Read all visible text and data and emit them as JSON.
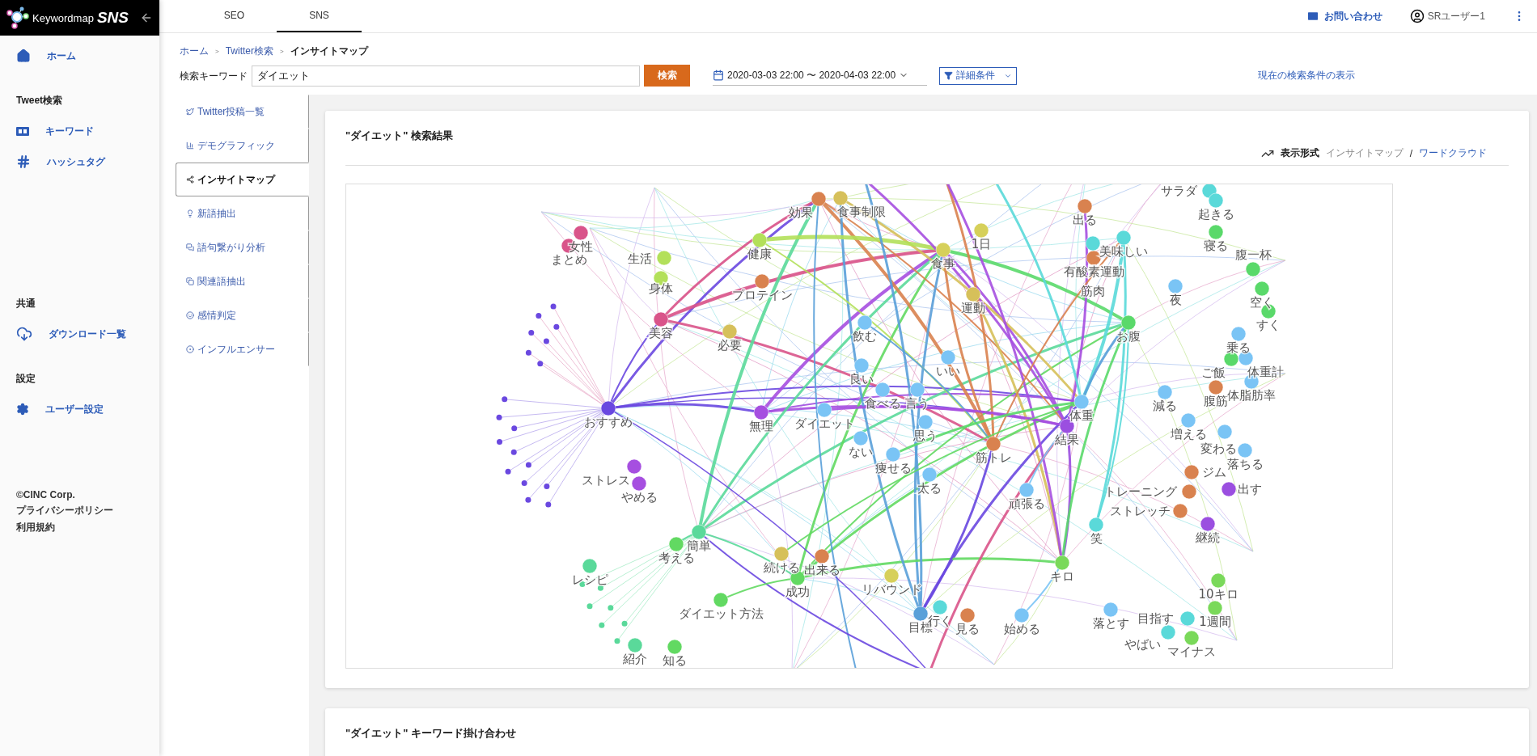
{
  "logo": {
    "name": "Keywordmap",
    "product": "SNS"
  },
  "sidebar": {
    "groups": [
      {
        "items": [
          {
            "label": "ホーム"
          }
        ]
      },
      {
        "heading": "Tweet検索",
        "items": [
          {
            "label": "キーワード"
          },
          {
            "label": "ハッシュタグ"
          }
        ]
      },
      {
        "heading": "共通",
        "items": [
          {
            "label": "ダウンロード一覧"
          }
        ]
      },
      {
        "heading": "設定",
        "items": [
          {
            "label": "ユーザー設定"
          }
        ]
      }
    ],
    "footer": [
      "©CINC Corp.",
      "プライバシーポリシー",
      "利用規約"
    ]
  },
  "top_tabs": [
    {
      "label": "SEO",
      "selected": false
    },
    {
      "label": "SNS",
      "selected": true
    }
  ],
  "header": {
    "contact": "お問い合わせ",
    "user": "SRユーザー1"
  },
  "breadcrumb": [
    "ホーム",
    "Twitter検索",
    "インサイトマップ"
  ],
  "breadcrumb_separator": ">",
  "search": {
    "label": "検索キーワード",
    "value": "ダイエット",
    "button": "検索",
    "date_range": "2020-03-03 22:00 〜 2020-04-03 22:00",
    "filter": "詳細条件",
    "show_conditions": "現在の検索条件の表示"
  },
  "subnav": [
    {
      "label": "Twitter投稿一覧",
      "selected": false
    },
    {
      "label": "デモグラフィック",
      "selected": false
    },
    {
      "label": "インサイトマップ",
      "selected": true
    },
    {
      "label": "新語抽出",
      "selected": false
    },
    {
      "label": "語句繋がり分析",
      "selected": false
    },
    {
      "label": "関連語抽出",
      "selected": false
    },
    {
      "label": "感情判定",
      "selected": false
    },
    {
      "label": "インフルエンサー",
      "selected": false
    }
  ],
  "result_card": {
    "title": "\"ダイエット\" 検索結果",
    "display_label": "表示形式",
    "display_separator": "/",
    "display_options": [
      {
        "label": "インサイトマップ",
        "selected": true
      },
      {
        "label": "ワードクラウド",
        "selected": false
      }
    ]
  },
  "network": {
    "nodes": [
      {
        "label": "女性",
        "color": "#d9548a"
      },
      {
        "label": "まとめ",
        "color": "#d9548a"
      },
      {
        "label": "生活",
        "color": "#b3e05a"
      },
      {
        "label": "身体",
        "color": "#b3e05a"
      },
      {
        "label": "美容",
        "color": "#d9548a"
      },
      {
        "label": "健康",
        "color": "#b3e05a"
      },
      {
        "label": "プロテイン",
        "color": "#d9824f"
      },
      {
        "label": "必要",
        "color": "#d6c05a"
      },
      {
        "label": "効果",
        "color": "#d9824f"
      },
      {
        "label": "食事制限",
        "color": "#d6c05a"
      },
      {
        "label": "食事",
        "color": "#d6d05a"
      },
      {
        "label": "おすすめ",
        "color": "#6a48e0"
      },
      {
        "label": "無理",
        "color": "#a64fe0"
      },
      {
        "label": "ストレス",
        "color": "#a64fe0"
      },
      {
        "label": "やめる",
        "color": "#a64fe0"
      },
      {
        "label": "簡単",
        "color": "#5ad99a"
      },
      {
        "label": "考える",
        "color": "#62d962"
      },
      {
        "label": "レシピ",
        "color": "#5ad99a"
      },
      {
        "label": "続ける",
        "color": "#d6c05a"
      },
      {
        "label": "出来る",
        "color": "#d9824f"
      },
      {
        "label": "成功",
        "color": "#62d962"
      },
      {
        "label": "リバウンド",
        "color": "#d6d05a"
      },
      {
        "label": "ダイエット方法",
        "color": "#62d962"
      },
      {
        "label": "紹介",
        "color": "#5ad99a"
      },
      {
        "label": "知る",
        "color": "#62d962"
      },
      {
        "label": "飲む",
        "color": "#7ac4f5"
      },
      {
        "label": "良い",
        "color": "#7ac4f5"
      },
      {
        "label": "食べる",
        "color": "#7ac4f5"
      },
      {
        "label": "言う",
        "color": "#7ac4f5"
      },
      {
        "label": "ダイエット",
        "color": "#7ac4f5"
      },
      {
        "label": "ない",
        "color": "#7ac4f5"
      },
      {
        "label": "痩せる",
        "color": "#7ac4f5"
      },
      {
        "label": "思う",
        "color": "#7ac4f5"
      },
      {
        "label": "太る",
        "color": "#7ac4f5"
      },
      {
        "label": "出る",
        "color": "#d9824f"
      },
      {
        "label": "1日",
        "color": "#d6d05a"
      },
      {
        "label": "美味しい",
        "color": "#5ad9d9"
      },
      {
        "label": "有酸素運動",
        "color": "#d9824f"
      },
      {
        "label": "筋肉",
        "color": "#5ad9d9"
      },
      {
        "label": "運動",
        "color": "#d6c05a"
      },
      {
        "label": "いい",
        "color": "#7ac4f5"
      },
      {
        "label": "お腹",
        "color": "#5ad96a"
      },
      {
        "label": "サラダ",
        "color": "#5ad9d9"
      },
      {
        "label": "起きる",
        "color": "#5ad9d9"
      },
      {
        "label": "寝る",
        "color": "#5ad96a"
      },
      {
        "label": "夜",
        "color": "#7ac4f5"
      },
      {
        "label": "腹一杯",
        "color": "#5ad96a"
      },
      {
        "label": "空く",
        "color": "#5ad96a"
      },
      {
        "label": "すく",
        "color": "#5ad96a"
      },
      {
        "label": "乗る",
        "color": "#7ac4f5"
      },
      {
        "label": "ご飯",
        "color": "#5ad96a"
      },
      {
        "label": "体重計",
        "color": "#7ac4f5"
      },
      {
        "label": "体脂肪率",
        "color": "#7ac4f5"
      },
      {
        "label": "減る",
        "color": "#7ac4f5"
      },
      {
        "label": "腹筋",
        "color": "#d9824f"
      },
      {
        "label": "体重",
        "color": "#7ac4f5"
      },
      {
        "label": "結果",
        "color": "#9b4fe0"
      },
      {
        "label": "筋トレ",
        "color": "#d9824f"
      },
      {
        "label": "増える",
        "color": "#7ac4f5"
      },
      {
        "label": "変わる",
        "color": "#7ac4f5"
      },
      {
        "label": "落ちる",
        "color": "#7ac4f5"
      },
      {
        "label": "ジム",
        "color": "#d9824f"
      },
      {
        "label": "トレーニング",
        "color": "#d9824f"
      },
      {
        "label": "出す",
        "color": "#9b4fe0"
      },
      {
        "label": "ストレッチ",
        "color": "#d9824f"
      },
      {
        "label": "継続",
        "color": "#9b4fe0"
      },
      {
        "label": "頑張る",
        "color": "#7ac4f5"
      },
      {
        "label": "笑",
        "color": "#5ad9d9"
      },
      {
        "label": "キロ",
        "color": "#7ad95a"
      },
      {
        "label": "10キロ",
        "color": "#7ad95a"
      },
      {
        "label": "目標",
        "color": "#5aa0d9"
      },
      {
        "label": "行く",
        "color": "#5ad9d9"
      },
      {
        "label": "見る",
        "color": "#d9824f"
      },
      {
        "label": "始める",
        "color": "#7ac4f5"
      },
      {
        "label": "落とす",
        "color": "#7ac4f5"
      },
      {
        "label": "目指す",
        "color": "#5ad9d9"
      },
      {
        "label": "1週間",
        "color": "#7ad95a"
      },
      {
        "label": "やばい",
        "color": "#5ad9d9"
      },
      {
        "label": "マイナス",
        "color": "#7ad95a"
      }
    ]
  },
  "combo_card": {
    "title": "\"ダイエット\" キーワード掛け合わせ"
  }
}
